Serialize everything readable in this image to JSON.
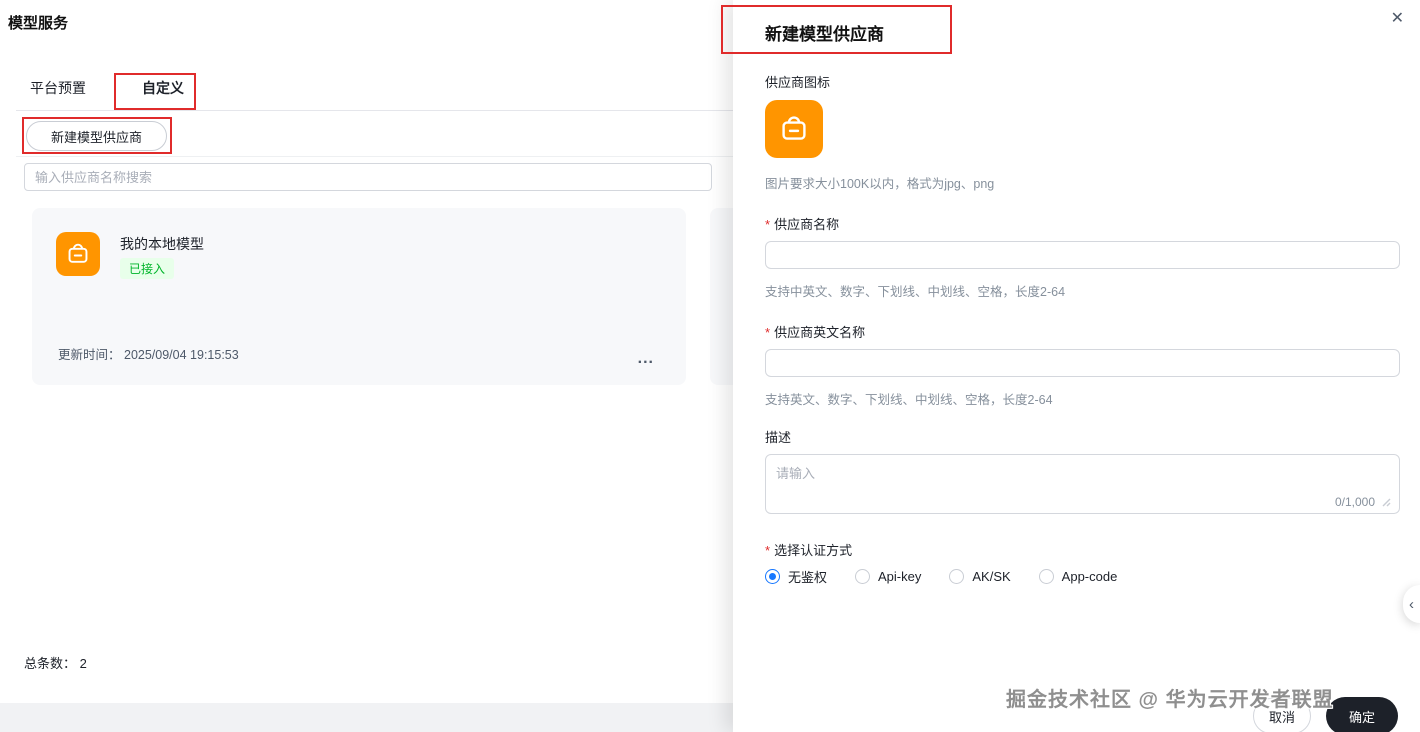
{
  "page": {
    "title": "模型服务",
    "tabs": [
      {
        "label": "平台预置",
        "active": false
      },
      {
        "label": "自定义",
        "active": true
      }
    ],
    "toolbar": {
      "create_button": "新建模型供应商",
      "search_placeholder": "输入供应商名称搜索"
    },
    "cards": [
      {
        "title": "我的本地模型",
        "status": "已接入",
        "updated_label": "更新时间：",
        "updated_time": "2025/09/04 19:15:53",
        "more_icon": "..."
      }
    ],
    "summary": {
      "total_label": "总条数：",
      "total_value": "2"
    }
  },
  "drawer": {
    "title": "新建模型供应商",
    "close_icon": "✕",
    "required_mark": "*",
    "icon_section": {
      "label": "供应商图标",
      "hint": "图片要求大小100K以内，格式为jpg、png"
    },
    "name_field": {
      "label": "供应商名称",
      "hint": "支持中英文、数字、下划线、中划线、空格，长度2-64",
      "value": ""
    },
    "en_name_field": {
      "label": "供应商英文名称",
      "hint": "支持英文、数字、下划线、中划线、空格，长度2-64",
      "value": ""
    },
    "description_field": {
      "label": "描述",
      "placeholder": "请输入",
      "counter": "0/1,000"
    },
    "auth_field": {
      "label": "选择认证方式",
      "options": [
        {
          "label": "无鉴权",
          "selected": true
        },
        {
          "label": "Api-key",
          "selected": false
        },
        {
          "label": "AK/SK",
          "selected": false
        },
        {
          "label": "App-code",
          "selected": false
        }
      ]
    },
    "actions": {
      "cancel": "取消",
      "confirm": "确定"
    }
  },
  "watermark": "掘金技术社区 @ 华为云开发者联盟",
  "collapse_handle_icon": "‹",
  "colors": {
    "brand_orange": "#ff9500",
    "status_green": "#00b42a",
    "status_green_bg": "#e8ffea",
    "radio_blue": "#1677ff",
    "annotation_red": "#e02b2b",
    "confirm_black": "#1d2129"
  }
}
